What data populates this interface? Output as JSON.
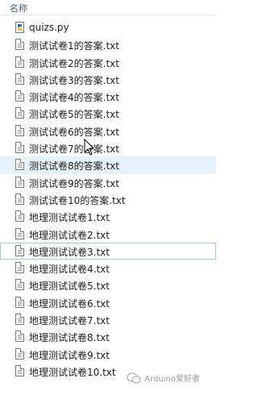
{
  "header": {
    "name_col": "名称"
  },
  "files": [
    {
      "name": "quizs.py",
      "icon": "python-file-icon"
    },
    {
      "name": "测试试卷1的答案.txt",
      "icon": "text-file-icon"
    },
    {
      "name": "测试试卷2的答案.txt",
      "icon": "text-file-icon"
    },
    {
      "name": "测试试卷3的答案.txt",
      "icon": "text-file-icon"
    },
    {
      "name": "测试试卷4的答案.txt",
      "icon": "text-file-icon"
    },
    {
      "name": "测试试卷5的答案.txt",
      "icon": "text-file-icon"
    },
    {
      "name": "测试试卷6的答案.txt",
      "icon": "text-file-icon"
    },
    {
      "name": "测试试卷7的答案.txt",
      "icon": "text-file-icon"
    },
    {
      "name": "测试试卷8的答案.txt",
      "icon": "text-file-icon"
    },
    {
      "name": "测试试卷9的答案.txt",
      "icon": "text-file-icon"
    },
    {
      "name": "测试试卷10的答案.txt",
      "icon": "text-file-icon"
    },
    {
      "name": "地理测试试卷1.txt",
      "icon": "text-file-icon"
    },
    {
      "name": "地理测试试卷2.txt",
      "icon": "text-file-icon"
    },
    {
      "name": "地理测试试卷3.txt",
      "icon": "text-file-icon"
    },
    {
      "name": "地理测试试卷4.txt",
      "icon": "text-file-icon"
    },
    {
      "name": "地理测试试卷5.txt",
      "icon": "text-file-icon"
    },
    {
      "name": "地理测试试卷6.txt",
      "icon": "text-file-icon"
    },
    {
      "name": "地理测试试卷7.txt",
      "icon": "text-file-icon"
    },
    {
      "name": "地理测试试卷8.txt",
      "icon": "text-file-icon"
    },
    {
      "name": "地理测试试卷9.txt",
      "icon": "text-file-icon"
    },
    {
      "name": "地理测试试卷10.txt",
      "icon": "text-file-icon"
    }
  ],
  "hover_row_index": 8,
  "focused_row_index": 13,
  "watermark": {
    "text": "Arduino爱好者",
    "icon": "wechat-icon"
  },
  "colors": {
    "hover": "#e5f1fb",
    "focus": "#99c9ef",
    "header_text": "#4c607a"
  }
}
